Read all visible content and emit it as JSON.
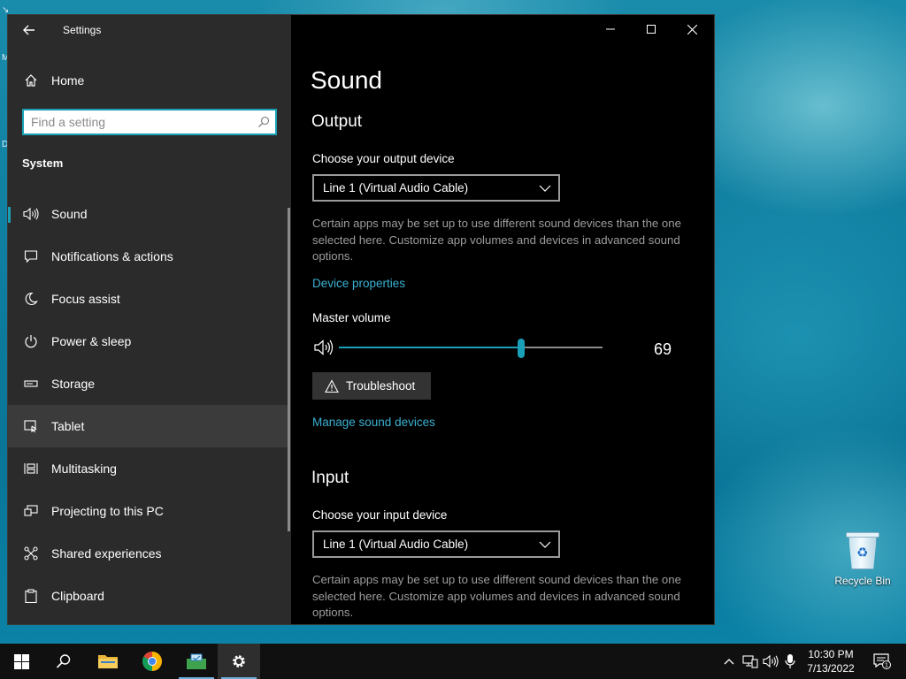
{
  "window": {
    "title": "Settings",
    "controls": {
      "minimize": "—",
      "maximize": "☐",
      "close": "✕"
    }
  },
  "sidebar": {
    "home_label": "Home",
    "search_placeholder": "Find a setting",
    "section_heading": "System",
    "items": [
      {
        "label": "Sound",
        "icon": "speaker-icon",
        "selected": true
      },
      {
        "label": "Notifications & actions",
        "icon": "notifications-icon"
      },
      {
        "label": "Focus assist",
        "icon": "moon-icon"
      },
      {
        "label": "Power & sleep",
        "icon": "power-icon"
      },
      {
        "label": "Storage",
        "icon": "storage-icon"
      },
      {
        "label": "Tablet",
        "icon": "tablet-icon",
        "hover": true
      },
      {
        "label": "Multitasking",
        "icon": "multitasking-icon"
      },
      {
        "label": "Projecting to this PC",
        "icon": "projecting-icon"
      },
      {
        "label": "Shared experiences",
        "icon": "shared-experiences-icon"
      },
      {
        "label": "Clipboard",
        "icon": "clipboard-icon"
      }
    ]
  },
  "content": {
    "page_title": "Sound",
    "output": {
      "heading": "Output",
      "device_label": "Choose your output device",
      "device_value": "Line 1 (Virtual Audio Cable)",
      "help_text": "Certain apps may be set up to use different sound devices than the one selected here. Customize app volumes and devices in advanced sound options.",
      "device_properties_link": "Device properties",
      "master_volume_label": "Master volume",
      "master_volume_value": "69",
      "master_volume_level": 69,
      "troubleshoot_label": "Troubleshoot",
      "manage_link": "Manage sound devices"
    },
    "input": {
      "heading": "Input",
      "device_label": "Choose your input device",
      "device_value": "Line 1 (Virtual Audio Cable)",
      "help_text": "Certain apps may be set up to use different sound devices than the one selected here. Customize app volumes and devices in advanced sound options."
    }
  },
  "desktop": {
    "recycle_bin_label": "Recycle Bin"
  },
  "taskbar": {
    "apps": [
      "start-button",
      "search-button",
      "file-explorer",
      "chrome",
      "app",
      "settings"
    ],
    "clock_time": "10:30 PM",
    "clock_date": "7/13/2022",
    "notification_count": "1"
  },
  "colors": {
    "accent": "#1aa0b6",
    "link": "#3ab0d0",
    "sidebar_bg": "#2b2b2b",
    "content_bg": "#000000"
  }
}
